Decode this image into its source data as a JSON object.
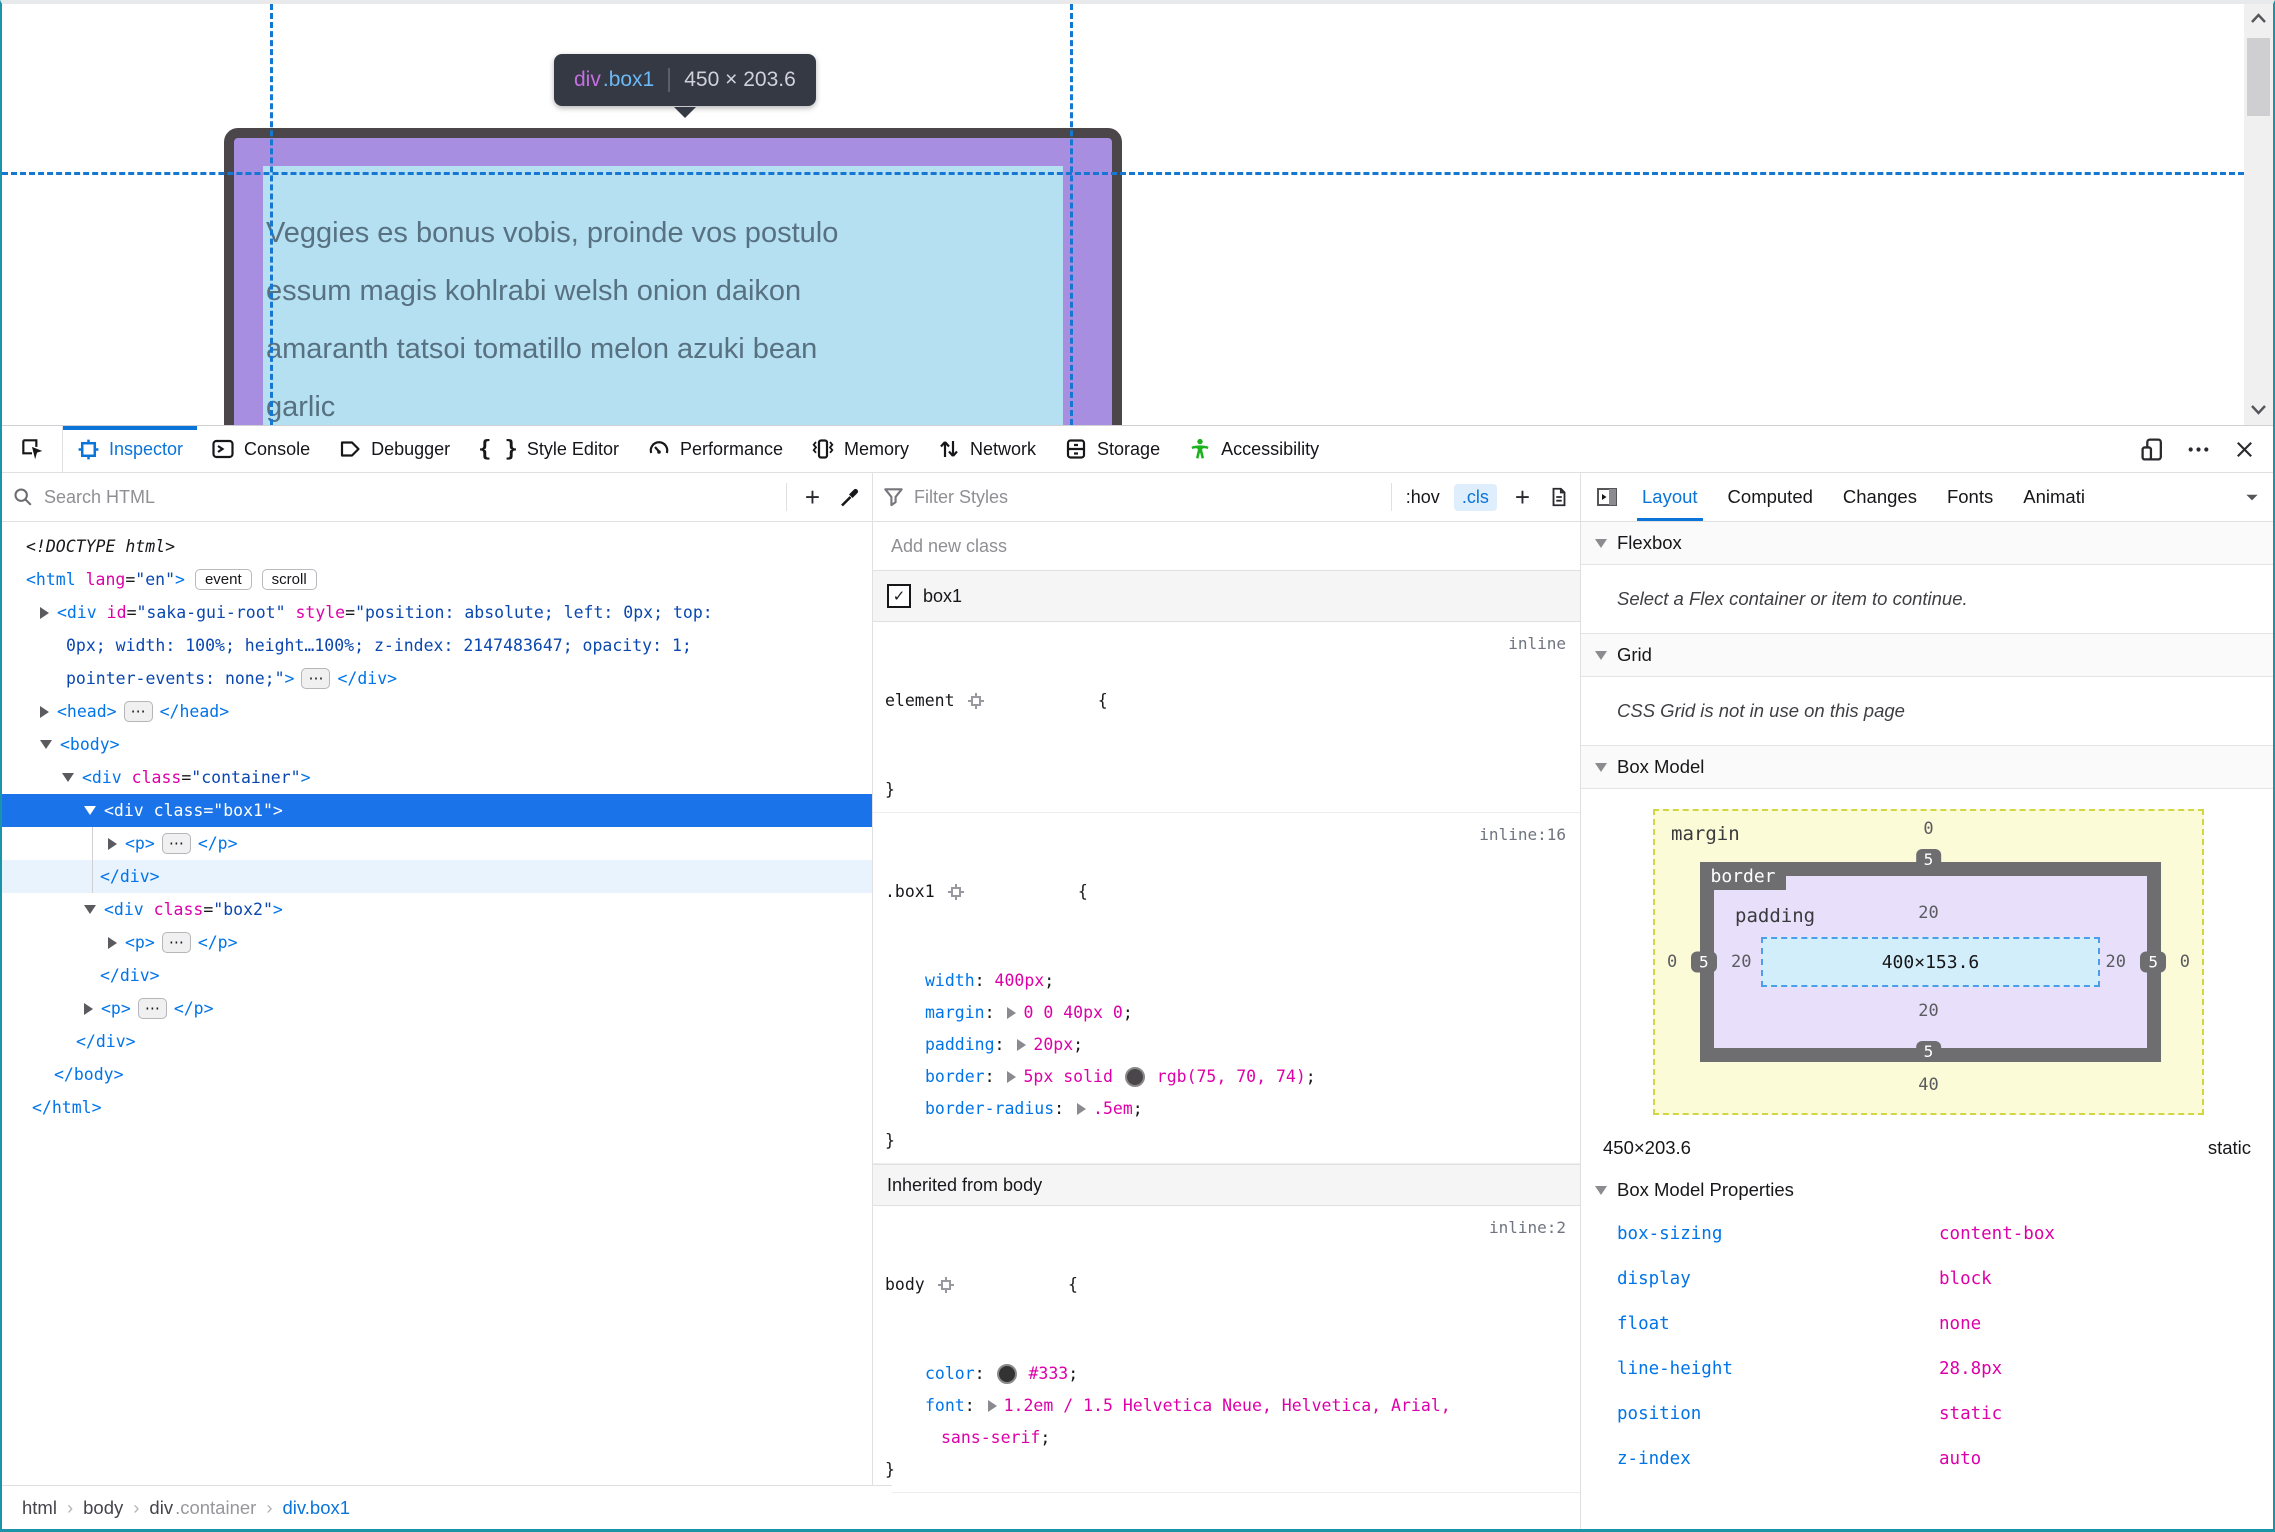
{
  "page": {
    "tooltip": {
      "tag": "div",
      "cls": ".box1",
      "dims": "450 × 203.6"
    },
    "lines": [
      "Veggies es bonus vobis, proinde vos postulo",
      "essum magis kohlrabi welsh onion daikon",
      "amaranth tatsoi tomatillo melon azuki bean",
      "garlic"
    ]
  },
  "toolbar": {
    "tabs": [
      "Inspector",
      "Console",
      "Debugger",
      "Style Editor",
      "Performance",
      "Memory",
      "Network",
      "Storage",
      "Accessibility"
    ]
  },
  "markup": {
    "search_placeholder": "Search HTML",
    "rows": [
      {
        "tokens": [
          {
            "c": "doct",
            "t": "<!DOCTYPE html>"
          }
        ]
      },
      {
        "tokens": [
          {
            "c": "tag",
            "t": "<html"
          },
          {
            "c": "attr",
            "t": " lang"
          },
          {
            "c": "pl",
            "t": "="
          },
          {
            "c": "val",
            "t": "\"en\""
          },
          {
            "c": "tag",
            "t": ">"
          },
          {
            "c": "badge",
            "t": "event"
          },
          {
            "c": "badge",
            "t": "scroll"
          }
        ]
      },
      {
        "tokens": [
          {
            "c": "arr"
          },
          {
            "c": "tag",
            "t": "<div"
          },
          {
            "c": "attr",
            "t": " id"
          },
          {
            "c": "pl",
            "t": "="
          },
          {
            "c": "val",
            "t": "\"saka-gui-root\""
          },
          {
            "c": "attr",
            "t": " style"
          },
          {
            "c": "pl",
            "t": "="
          },
          {
            "c": "val",
            "t": "\"position: absolute; left: 0px; top:"
          }
        ]
      },
      {
        "tokens": [
          {
            "c": "val",
            "t": "0px; width: 100%; height…100%; z-index: 2147483647; opacity: 1;"
          }
        ]
      },
      {
        "tokens": [
          {
            "c": "val",
            "t": "pointer-events: none;\""
          },
          {
            "c": "tag",
            "t": ">"
          },
          {
            "c": "dots",
            "t": "⋯"
          },
          {
            "c": "tag",
            "t": "</div>"
          }
        ]
      },
      {
        "tokens": [
          {
            "c": "arr"
          },
          {
            "c": "tag",
            "t": "<head>"
          },
          {
            "c": "dots",
            "t": "⋯"
          },
          {
            "c": "tag",
            "t": "</head>"
          }
        ]
      },
      {
        "tokens": [
          {
            "c": "arrd"
          },
          {
            "c": "tag",
            "t": "<body>"
          }
        ]
      },
      {
        "tokens": [
          {
            "c": "arrd"
          },
          {
            "c": "tag",
            "t": "<div"
          },
          {
            "c": "attr",
            "t": " class"
          },
          {
            "c": "pl",
            "t": "="
          },
          {
            "c": "val",
            "t": "\"container\""
          },
          {
            "c": "tag",
            "t": ">"
          }
        ]
      },
      {
        "tokens": [
          {
            "c": "arrw"
          },
          {
            "c": "wh",
            "t": "<div class=\"box1\">"
          }
        ]
      },
      {
        "tokens": [
          {
            "c": "arr"
          },
          {
            "c": "tag",
            "t": "<p>"
          },
          {
            "c": "dots",
            "t": "⋯"
          },
          {
            "c": "tag",
            "t": "</p>"
          }
        ]
      },
      {
        "tokens": [
          {
            "c": "tag",
            "t": "</div>"
          }
        ]
      },
      {
        "tokens": [
          {
            "c": "arrd"
          },
          {
            "c": "tag",
            "t": "<div"
          },
          {
            "c": "attr",
            "t": " class"
          },
          {
            "c": "pl",
            "t": "="
          },
          {
            "c": "val",
            "t": "\"box2\""
          },
          {
            "c": "tag",
            "t": ">"
          }
        ]
      },
      {
        "tokens": [
          {
            "c": "arr"
          },
          {
            "c": "tag",
            "t": "<p>"
          },
          {
            "c": "dots",
            "t": "⋯"
          },
          {
            "c": "tag",
            "t": "</p>"
          }
        ]
      },
      {
        "tokens": [
          {
            "c": "tag",
            "t": "</div>"
          }
        ]
      },
      {
        "tokens": [
          {
            "c": "arr"
          },
          {
            "c": "tag",
            "t": "<p>"
          },
          {
            "c": "dots",
            "t": "⋯"
          },
          {
            "c": "tag",
            "t": "</p>"
          }
        ]
      },
      {
        "tokens": [
          {
            "c": "tag",
            "t": "</div>"
          }
        ]
      },
      {
        "tokens": [
          {
            "c": "tag",
            "t": "</body>"
          }
        ]
      },
      {
        "tokens": [
          {
            "c": "tag",
            "t": "</html>"
          }
        ]
      }
    ]
  },
  "rules": {
    "filter_placeholder": "Filter Styles",
    "pseudo_label": ":hov",
    "class_label": ".cls",
    "add_label": "+",
    "addclass_placeholder": "Add new class",
    "class_toggle": "box1",
    "element_rule": {
      "selector": "element",
      "brace": "{",
      "close": "}",
      "link": "inline"
    },
    "box1_rule": {
      "selector": ".box1",
      "brace": "{",
      "close": "}",
      "link": "inline:16",
      "props": [
        [
          {
            "c": "pn",
            "t": "width"
          },
          {
            "c": "pl",
            "t": ": "
          },
          {
            "c": "pv",
            "t": "400px"
          },
          {
            "c": "pl",
            "t": ";"
          }
        ],
        [
          {
            "c": "pn",
            "t": "margin"
          },
          {
            "c": "pl",
            "t": ": "
          },
          {
            "c": "rexp"
          },
          {
            "c": "pv",
            "t": "0 0 40px 0"
          },
          {
            "c": "pl",
            "t": ";"
          }
        ],
        [
          {
            "c": "pn",
            "t": "padding"
          },
          {
            "c": "pl",
            "t": ": "
          },
          {
            "c": "rexp"
          },
          {
            "c": "pv",
            "t": "20px"
          },
          {
            "c": "pl",
            "t": ";"
          }
        ],
        [
          {
            "c": "pn",
            "t": "border"
          },
          {
            "c": "pl",
            "t": ": "
          },
          {
            "c": "rexp"
          },
          {
            "c": "pv",
            "t": "5px solid "
          },
          {
            "c": "sw sw1"
          },
          {
            "c": "pv",
            "t": " rgb(75, 70, 74)"
          },
          {
            "c": "pl",
            "t": ";"
          }
        ],
        [
          {
            "c": "pn",
            "t": "border-radius"
          },
          {
            "c": "pl",
            "t": ": "
          },
          {
            "c": "rexp"
          },
          {
            "c": "pv",
            "t": ".5em"
          },
          {
            "c": "pl",
            "t": ";"
          }
        ]
      ]
    },
    "inherited_header": "Inherited from body",
    "body_rule": {
      "selector": "body",
      "brace": "{",
      "close": "}",
      "link": "inline:2",
      "props": [
        [
          {
            "c": "pn",
            "t": "color"
          },
          {
            "c": "pl",
            "t": ": "
          },
          {
            "c": "sw sw2"
          },
          {
            "c": "pv",
            "t": " #333"
          },
          {
            "c": "pl",
            "t": ";"
          }
        ],
        [
          {
            "c": "pn",
            "t": "font"
          },
          {
            "c": "pl",
            "t": ": "
          },
          {
            "c": "rexp"
          },
          {
            "c": "pv",
            "t": "1.2em / 1.5 Helvetica Neue, Helvetica, Arial,"
          }
        ]
      ],
      "cont": [
        [
          {
            "c": "pv",
            "t": "sans-serif"
          },
          {
            "c": "pl",
            "t": ";"
          }
        ]
      ]
    }
  },
  "layout": {
    "tabs": [
      "Layout",
      "Computed",
      "Changes",
      "Fonts",
      "Animati"
    ],
    "flex_header": "Flexbox",
    "flex_msg": "Select a Flex container or item to continue.",
    "grid_header": "Grid",
    "grid_msg": "CSS Grid is not in use on this page",
    "bm_header": "Box Model",
    "bm": {
      "margin_label": "margin",
      "border_label": "border",
      "padding_label": "padding",
      "content": "400×153.6",
      "m_top": "0",
      "m_right": "0",
      "m_bottom": "40",
      "m_left": "0",
      "b_top": "5",
      "b_right": "5",
      "b_bottom": "5",
      "b_left": "5",
      "p_top": "20",
      "p_right": "20",
      "p_bottom": "20",
      "p_left": "20"
    },
    "dims": "450×203.6",
    "position": "static",
    "bmp_header": "Box Model Properties",
    "props": [
      {
        "n": "box-sizing",
        "v": "content-box"
      },
      {
        "n": "display",
        "v": "block"
      },
      {
        "n": "float",
        "v": "none"
      },
      {
        "n": "line-height",
        "v": "28.8px"
      },
      {
        "n": "position",
        "v": "static"
      },
      {
        "n": "z-index",
        "v": "auto"
      }
    ]
  },
  "breadcrumb": {
    "tokens": [
      {
        "c": "crumb",
        "t": "html"
      },
      {
        "c": "sep",
        "t": "›"
      },
      {
        "c": "crumb",
        "t": "body"
      },
      {
        "c": "sep",
        "t": "›"
      },
      {
        "c": "crumb",
        "t": "div"
      },
      {
        "c": "crumbdim",
        "t": ".container"
      },
      {
        "c": "sep",
        "t": "›"
      },
      {
        "c": "crumbsel",
        "t": "div.box1"
      }
    ]
  }
}
